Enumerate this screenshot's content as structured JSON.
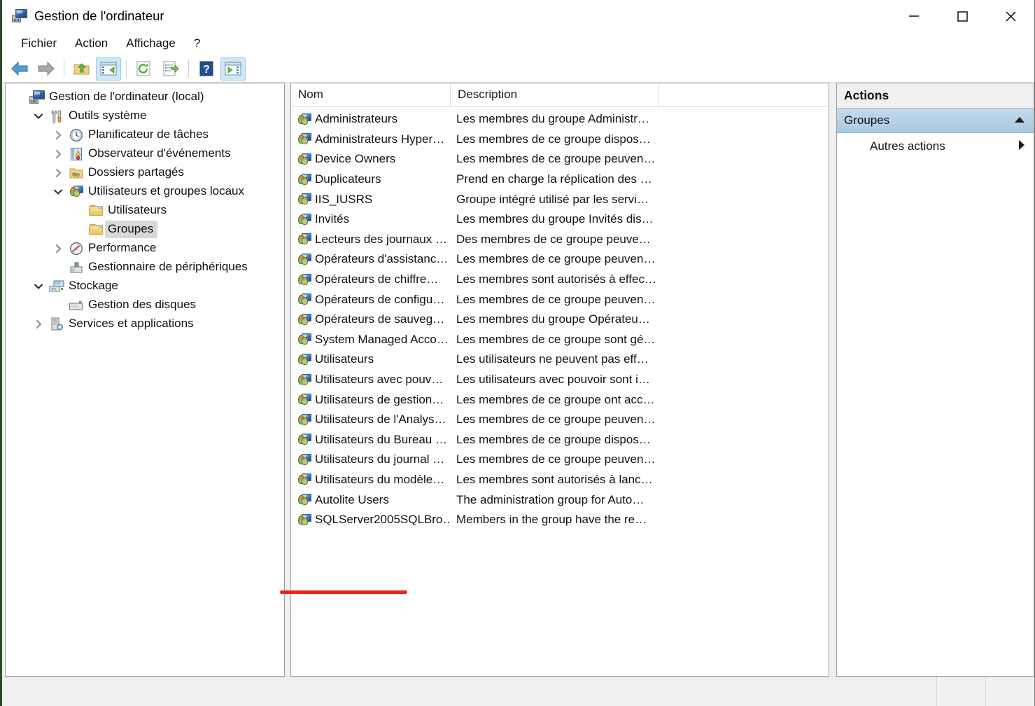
{
  "window": {
    "title": "Gestion de l'ordinateur",
    "app_icon": "computer-management-icon",
    "controls": {
      "minimize": "minimize-icon",
      "maximize": "maximize-icon",
      "close": "close-icon"
    }
  },
  "menubar": {
    "items": [
      {
        "label": "Fichier",
        "name": "menu-fichier"
      },
      {
        "label": "Action",
        "name": "menu-action"
      },
      {
        "label": "Affichage",
        "name": "menu-affichage"
      },
      {
        "label": "?",
        "name": "menu-help"
      }
    ]
  },
  "toolbar": {
    "buttons": [
      {
        "name": "back-button",
        "icon": "back-arrow-icon",
        "active": false
      },
      {
        "name": "forward-button",
        "icon": "forward-arrow-icon",
        "active": false
      },
      {
        "name": "up-one-level-button",
        "icon": "folder-up-icon",
        "active": false
      },
      {
        "name": "show-hide-console-tree-button",
        "icon": "console-tree-icon",
        "active": true
      },
      {
        "name": "refresh-button",
        "icon": "refresh-icon",
        "active": false
      },
      {
        "name": "export-list-button",
        "icon": "export-list-icon",
        "active": false
      },
      {
        "name": "help-button",
        "icon": "help-question-icon",
        "active": false
      },
      {
        "name": "show-hide-action-pane-button",
        "icon": "action-pane-icon",
        "active": true
      }
    ]
  },
  "tree": {
    "nodes": [
      {
        "label": "Gestion de l'ordinateur (local)",
        "indent": 0,
        "twisty": "none",
        "icon": "computer-management-icon",
        "selected": false
      },
      {
        "label": "Outils système",
        "indent": 1,
        "twisty": "expanded",
        "icon": "system-tools-icon",
        "selected": false
      },
      {
        "label": "Planificateur de tâches",
        "indent": 2,
        "twisty": "collapsed",
        "icon": "task-scheduler-clock-icon",
        "selected": false
      },
      {
        "label": "Observateur d'événements",
        "indent": 2,
        "twisty": "collapsed",
        "icon": "event-viewer-icon",
        "selected": false
      },
      {
        "label": "Dossiers partagés",
        "indent": 2,
        "twisty": "collapsed",
        "icon": "shared-folders-icon",
        "selected": false
      },
      {
        "label": "Utilisateurs et groupes locaux",
        "indent": 2,
        "twisty": "expanded",
        "icon": "local-users-groups-icon",
        "selected": false
      },
      {
        "label": "Utilisateurs",
        "indent": 3,
        "twisty": "none",
        "icon": "folder-icon",
        "selected": false
      },
      {
        "label": "Groupes",
        "indent": 3,
        "twisty": "none",
        "icon": "folder-icon",
        "selected": true
      },
      {
        "label": "Performance",
        "indent": 2,
        "twisty": "collapsed",
        "icon": "performance-gauge-icon",
        "selected": false
      },
      {
        "label": "Gestionnaire de périphériques",
        "indent": 2,
        "twisty": "none",
        "icon": "device-manager-icon",
        "selected": false
      },
      {
        "label": "Stockage",
        "indent": 1,
        "twisty": "expanded",
        "icon": "storage-icon",
        "selected": false
      },
      {
        "label": "Gestion des disques",
        "indent": 2,
        "twisty": "none",
        "icon": "disk-management-icon",
        "selected": false
      },
      {
        "label": "Services et applications",
        "indent": 1,
        "twisty": "collapsed",
        "icon": "services-applications-icon",
        "selected": false
      }
    ]
  },
  "list": {
    "columns": [
      {
        "label": "Nom",
        "name": "column-header-nom"
      },
      {
        "label": "Description",
        "name": "column-header-description"
      }
    ],
    "rows": [
      {
        "name": "Administrateurs",
        "description": "Les membres du groupe Administr…"
      },
      {
        "name": "Administrateurs Hyper…",
        "description": "Les membres de ce groupe dispos…"
      },
      {
        "name": "Device Owners",
        "description": "Les membres de ce groupe peuven…"
      },
      {
        "name": "Duplicateurs",
        "description": "Prend en charge la réplication des …"
      },
      {
        "name": "IIS_IUSRS",
        "description": "Groupe intégré utilisé par les servi…"
      },
      {
        "name": "Invités",
        "description": "Les membres du groupe Invités dis…"
      },
      {
        "name": "Lecteurs des journaux …",
        "description": "Des membres de ce groupe peuve…"
      },
      {
        "name": "Opérateurs d'assistanc…",
        "description": "Les membres de ce groupe peuven…"
      },
      {
        "name": "Opérateurs de chiffre…",
        "description": "Les membres sont autorisés à effec…"
      },
      {
        "name": "Opérateurs de configu…",
        "description": "Les membres de ce groupe peuven…"
      },
      {
        "name": "Opérateurs de sauveg…",
        "description": "Les membres du groupe Opérateu…"
      },
      {
        "name": "System Managed Acco…",
        "description": "Les membres de ce groupe sont gé…"
      },
      {
        "name": "Utilisateurs",
        "description": "Les utilisateurs ne peuvent pas eff…"
      },
      {
        "name": "Utilisateurs avec pouv…",
        "description": "Les utilisateurs avec pouvoir sont i…"
      },
      {
        "name": "Utilisateurs de gestion…",
        "description": "Les membres de ce groupe ont acc…"
      },
      {
        "name": "Utilisateurs de l'Analys…",
        "description": "Les membres de ce groupe peuven…"
      },
      {
        "name": "Utilisateurs du Bureau …",
        "description": "Les membres de ce groupe dispos…"
      },
      {
        "name": "Utilisateurs du journal …",
        "description": "Les membres de ce groupe peuven…"
      },
      {
        "name": "Utilisateurs du modèle…",
        "description": "Les membres sont autorisés à lanc…"
      },
      {
        "name": "Autolite Users",
        "description": "The administration group for Auto…"
      },
      {
        "name": "SQLServer2005SQLBro…",
        "description": "Members in the group have the re…"
      }
    ]
  },
  "actions": {
    "title": "Actions",
    "group_header": {
      "label": "Groupes",
      "collapse_icon": "chevron-up-icon"
    },
    "items": [
      {
        "label": "Autres actions",
        "submenu_icon": "chevron-right-icon"
      }
    ]
  },
  "annotation": {
    "color": "#e8261c",
    "target": "Autolite Users"
  },
  "statusbar": {
    "text": ""
  }
}
